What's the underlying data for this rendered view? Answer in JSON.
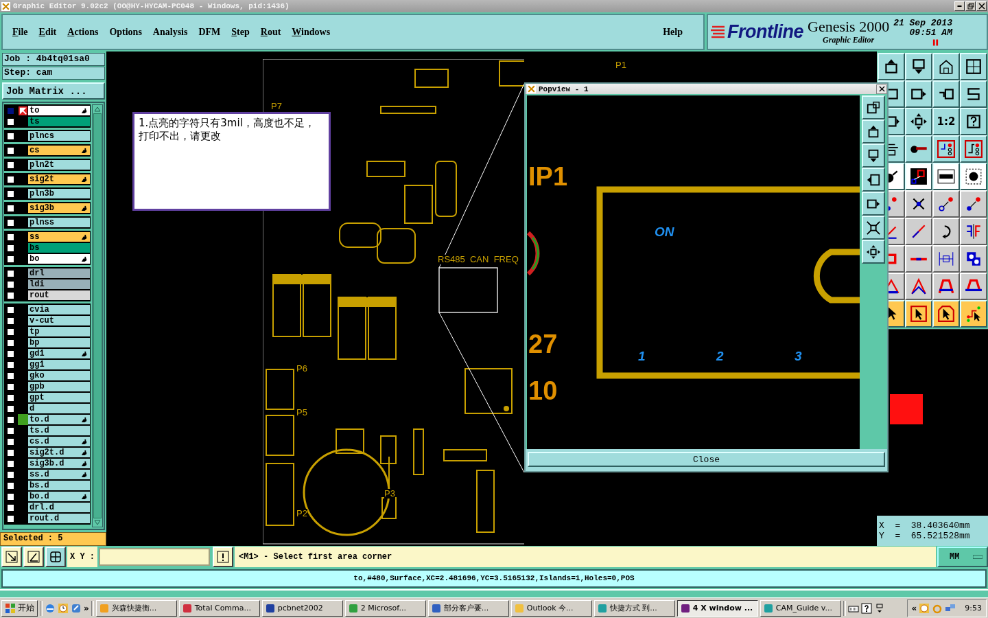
{
  "window": {
    "title": "Graphic Editor 9.02c2 (OO@HY-HYCAM-PC048 - Windows, pid:1436)"
  },
  "menu": [
    {
      "label": "File",
      "mnemonic": true
    },
    {
      "label": "Edit",
      "mnemonic": true
    },
    {
      "label": "Actions",
      "mnemonic": true
    },
    {
      "label": "Options",
      "mnemonic": false
    },
    {
      "label": "Analysis",
      "mnemonic": false
    },
    {
      "label": "DFM",
      "mnemonic": false
    },
    {
      "label": "Step",
      "mnemonic": true
    },
    {
      "label": "Rout",
      "mnemonic": true
    },
    {
      "label": "Windows",
      "mnemonic": true
    }
  ],
  "help_menu": "Help",
  "brand": {
    "logo": "Frontline",
    "product": "Genesis 2000",
    "subtitle": "Graphic Editor",
    "date": "21 Sep 2013",
    "time": "09:51 AM"
  },
  "job": "Job : 4b4tq01sa0",
  "step": "Step: cam",
  "job_matrix_button": "Job Matrix ...",
  "layer_groups": [
    {
      "layers": [
        {
          "name": "to",
          "color": "#ffffff",
          "affected": true,
          "work": true,
          "shown": false
        },
        {
          "name": "ts",
          "color": "#00a078",
          "affected": false,
          "work": false,
          "shown": false
        }
      ]
    },
    {
      "layers": [
        {
          "name": "plncs",
          "color": "#a0dcdc",
          "affected": false,
          "work": false,
          "shown": false
        }
      ]
    },
    {
      "layers": [
        {
          "name": "cs",
          "color": "#ffc850",
          "affected": true,
          "work": false,
          "shown": false
        }
      ]
    },
    {
      "layers": [
        {
          "name": "pln2t",
          "color": "#a0dcdc",
          "affected": false,
          "work": false,
          "shown": false
        }
      ]
    },
    {
      "layers": [
        {
          "name": "sig2t",
          "color": "#ffc850",
          "affected": true,
          "work": false,
          "shown": false
        }
      ]
    },
    {
      "layers": [
        {
          "name": "pln3b",
          "color": "#a0dcdc",
          "affected": false,
          "work": false,
          "shown": false
        }
      ]
    },
    {
      "layers": [
        {
          "name": "sig3b",
          "color": "#ffc850",
          "affected": true,
          "work": false,
          "shown": false
        }
      ]
    },
    {
      "layers": [
        {
          "name": "plnss",
          "color": "#a0dcdc",
          "affected": false,
          "work": false,
          "shown": false
        }
      ]
    },
    {
      "layers": [
        {
          "name": "ss",
          "color": "#ffc850",
          "affected": true,
          "work": false,
          "shown": false
        },
        {
          "name": "bs",
          "color": "#00a078",
          "affected": false,
          "work": false,
          "shown": false
        },
        {
          "name": "bo",
          "color": "#ffffff",
          "affected": true,
          "work": false,
          "shown": false
        }
      ]
    },
    {
      "layers": [
        {
          "name": "drl",
          "color": "#98b0b8",
          "affected": false,
          "work": false,
          "shown": false
        },
        {
          "name": "ldi",
          "color": "#98b0b8",
          "affected": false,
          "work": false,
          "shown": false
        },
        {
          "name": "rout",
          "color": "#d8d8d8",
          "affected": false,
          "work": false,
          "shown": false
        }
      ]
    },
    {
      "layers": [
        {
          "name": "cvia",
          "color": "#a0dcdc",
          "affected": false,
          "work": false,
          "shown": false
        },
        {
          "name": "v-cut",
          "color": "#a0dcdc",
          "affected": false,
          "work": false,
          "shown": false
        },
        {
          "name": "tp",
          "color": "#a0dcdc",
          "affected": false,
          "work": false,
          "shown": false
        },
        {
          "name": "bp",
          "color": "#a0dcdc",
          "affected": false,
          "work": false,
          "shown": false
        },
        {
          "name": "gd1",
          "color": "#a0dcdc",
          "affected": true,
          "work": false,
          "shown": false
        },
        {
          "name": "gg1",
          "color": "#a0dcdc",
          "affected": false,
          "work": false,
          "shown": false
        },
        {
          "name": "gko",
          "color": "#a0dcdc",
          "affected": false,
          "work": false,
          "shown": false
        },
        {
          "name": "gpb",
          "color": "#a0dcdc",
          "affected": false,
          "work": false,
          "shown": false
        },
        {
          "name": "gpt",
          "color": "#a0dcdc",
          "affected": false,
          "work": false,
          "shown": false
        },
        {
          "name": "d",
          "color": "#a0dcdc",
          "affected": false,
          "work": false,
          "shown": false
        },
        {
          "name": "to.d",
          "color": "#a0dcdc",
          "affected": true,
          "work": false,
          "shown": true
        },
        {
          "name": "ts.d",
          "color": "#a0dcdc",
          "affected": false,
          "work": false,
          "shown": false
        },
        {
          "name": "cs.d",
          "color": "#a0dcdc",
          "affected": true,
          "work": false,
          "shown": false
        },
        {
          "name": "sig2t.d",
          "color": "#a0dcdc",
          "affected": true,
          "work": false,
          "shown": false
        },
        {
          "name": "sig3b.d",
          "color": "#a0dcdc",
          "affected": true,
          "work": false,
          "shown": false
        },
        {
          "name": "ss.d",
          "color": "#a0dcdc",
          "affected": true,
          "work": false,
          "shown": false
        },
        {
          "name": "bs.d",
          "color": "#a0dcdc",
          "affected": false,
          "work": false,
          "shown": false
        },
        {
          "name": "bo.d",
          "color": "#a0dcdc",
          "affected": true,
          "work": false,
          "shown": false
        },
        {
          "name": "drl.d",
          "color": "#a0dcdc",
          "affected": false,
          "work": false,
          "shown": false
        },
        {
          "name": "rout.d",
          "color": "#a0dcdc",
          "affected": false,
          "work": false,
          "shown": false
        }
      ]
    }
  ],
  "selected_count": "Selected : 5",
  "board_labels": [
    "P1",
    "P7",
    "P6",
    "P5",
    "P3",
    "P2",
    "RS485  CAN  FREQ"
  ],
  "note": "1.点亮的字符只有3mil，高度也不足，打印不出，请更改",
  "popview": {
    "title": "Popview - 1",
    "labels": [
      "IP1",
      "27",
      "10"
    ],
    "pins": [
      "ON",
      "1",
      "2",
      "3"
    ],
    "close_button": "Close"
  },
  "toolbar": {
    "ratio_button": "1:2"
  },
  "coordinates": [
    "X  =  38.403640mm",
    "Y  =  65.521528mm"
  ],
  "command_bar": {
    "xy_label": "X Y :",
    "message": "<M1> - Select first area corner",
    "units": "MM"
  },
  "info_line": "to,#480,Surface,XC=2.481696,YC=3.5165132,Islands=1,Holes=0,POS",
  "taskbar": {
    "start": "开始",
    "more": "»",
    "tasks": [
      {
        "label": "兴森快捷衡...",
        "selected": false
      },
      {
        "label": "Total Comma...",
        "selected": false
      },
      {
        "label": "pcbnet2002",
        "selected": false
      },
      {
        "label": "2 Microsof...",
        "selected": false
      },
      {
        "label": "部分客户要...",
        "selected": false
      },
      {
        "label": "Outlook 今...",
        "selected": false
      },
      {
        "label": "快捷方式 到...",
        "selected": false
      },
      {
        "label": "4 X window ...",
        "selected": true
      },
      {
        "label": "CAM_Guide v...",
        "selected": false
      }
    ],
    "tray_more": "«",
    "clock": "9:53"
  }
}
